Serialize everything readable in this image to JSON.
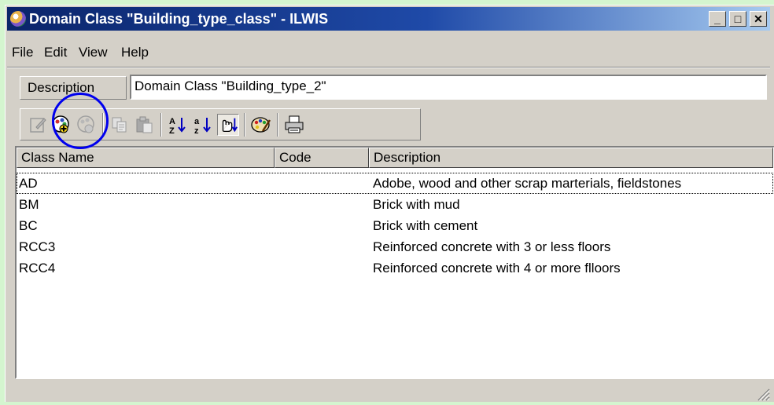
{
  "window": {
    "title": "Domain Class \"Building_type_class\" - ILWIS",
    "minimize_label": "_",
    "maximize_label": "□",
    "close_label": "✕"
  },
  "menu": [
    "File",
    "Edit",
    "View",
    "Help"
  ],
  "description_bar": {
    "label": "Description",
    "value": "Domain Class \"Building_type_2\""
  },
  "toolbar": {
    "buttons": [
      "edit-icon",
      "add-item-icon",
      "delete-item-icon",
      "copy-icon",
      "paste-icon",
      "sort-ascending-icon",
      "sort-descending-icon",
      "custom-sort-icon",
      "representation-icon",
      "print-icon"
    ],
    "highlighted": "add-item-icon",
    "highlight_color": "#0000ee"
  },
  "table": {
    "columns": [
      "Class Name",
      "Code",
      "Description"
    ],
    "rows": [
      {
        "name": "AD",
        "code": "",
        "description": "Adobe, wood and other scrap marterials, fieldstones"
      },
      {
        "name": "BM",
        "code": "",
        "description": "Brick with mud"
      },
      {
        "name": "BC",
        "code": "",
        "description": "Brick with cement"
      },
      {
        "name": "RCC3",
        "code": "",
        "description": "Reinforced concrete with 3 or less floors"
      },
      {
        "name": "RCC4",
        "code": "",
        "description": "Reinforced concrete with 4 or more flloors"
      }
    ],
    "selected_row": 0
  },
  "colors": {
    "title_start": "#0a246a",
    "title_end": "#a6caf0",
    "face": "#d4d0c8",
    "desktop": "#d4f5cf"
  }
}
